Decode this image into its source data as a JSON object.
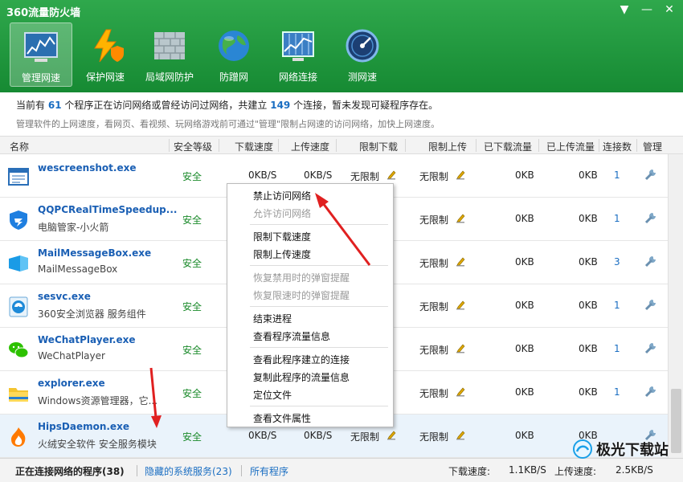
{
  "window": {
    "title": "360流量防火墙"
  },
  "nav": [
    {
      "label": "管理网速"
    },
    {
      "label": "保护网速"
    },
    {
      "label": "局域网防护"
    },
    {
      "label": "防蹭网"
    },
    {
      "label": "网络连接"
    },
    {
      "label": "测网速"
    }
  ],
  "info": {
    "pre": "当前有",
    "programs": "61",
    "mid": "个程序正在访问网络或曾经访问过网络，共建立",
    "connections": "149",
    "post": "个连接，暂未发现可疑程序存在。",
    "tip": "管理软件的上网速度，看网页、看视频、玩网络游戏前可通过\"管理\"限制占网速的访问网络，加快上网速度。"
  },
  "columns": [
    "名称",
    "安全等级",
    "下载速度",
    "上传速度",
    "限制下载",
    "限制上传",
    "已下载流量",
    "已上传流量",
    "连接数",
    "管理"
  ],
  "rows": [
    {
      "name": "wescreenshot.exe",
      "desc": "",
      "safety": "安全",
      "down": "0KB/S",
      "up": "0KB/S",
      "limit_down": "无限制",
      "limit_up": "无限制",
      "downloaded": "0KB",
      "uploaded": "0KB",
      "conns": "1"
    },
    {
      "name": "QQPCRealTimeSpeedup...",
      "desc": "电脑管家-小火箭",
      "safety": "安全",
      "down": "",
      "up": "",
      "limit_down": "",
      "limit_up": "无限制",
      "downloaded": "0KB",
      "uploaded": "0KB",
      "conns": "1"
    },
    {
      "name": "MailMessageBox.exe",
      "desc": "MailMessageBox",
      "safety": "安全",
      "down": "",
      "up": "",
      "limit_down": "",
      "limit_up": "无限制",
      "downloaded": "0KB",
      "uploaded": "0KB",
      "conns": "3"
    },
    {
      "name": "sesvc.exe",
      "desc": "360安全浏览器 服务组件",
      "safety": "安全",
      "down": "",
      "up": "",
      "limit_down": "",
      "limit_up": "无限制",
      "downloaded": "0KB",
      "uploaded": "0KB",
      "conns": "1"
    },
    {
      "name": "WeChatPlayer.exe",
      "desc": "WeChatPlayer",
      "safety": "安全",
      "down": "",
      "up": "",
      "limit_down": "",
      "limit_up": "无限制",
      "downloaded": "0KB",
      "uploaded": "0KB",
      "conns": "1"
    },
    {
      "name": "explorer.exe",
      "desc": "Windows资源管理器，它...",
      "safety": "安全",
      "down": "",
      "up": "",
      "limit_down": "",
      "limit_up": "无限制",
      "downloaded": "0KB",
      "uploaded": "0KB",
      "conns": "1"
    },
    {
      "name": "HipsDaemon.exe",
      "desc": "火绒安全软件 安全服务模块",
      "safety": "安全",
      "down": "0KB/S",
      "up": "0KB/S",
      "limit_down": "无限制",
      "limit_up": "无限制",
      "downloaded": "0KB",
      "uploaded": "0KB",
      "conns": ""
    }
  ],
  "context_menu": [
    {
      "label": "禁止访问网络",
      "enabled": true
    },
    {
      "label": "允许访问网络",
      "enabled": false
    },
    {
      "label": "限制下载速度",
      "enabled": true
    },
    {
      "label": "限制上传速度",
      "enabled": true
    },
    {
      "label": "恢复禁用时的弹窗提醒",
      "enabled": false
    },
    {
      "label": "恢复限速时的弹窗提醒",
      "enabled": false
    },
    {
      "label": "结束进程",
      "enabled": true
    },
    {
      "label": "查看程序流量信息",
      "enabled": true
    },
    {
      "label": "查看此程序建立的连接",
      "enabled": true
    },
    {
      "label": "复制此程序的流量信息",
      "enabled": true
    },
    {
      "label": "定位文件",
      "enabled": true
    },
    {
      "label": "查看文件属性",
      "enabled": true
    }
  ],
  "footer": {
    "tab_active": "正在连接网络的程序(38)",
    "tab_hidden": "隐藏的系统服务(23)",
    "tab_all": "所有程序",
    "down_label": "下载速度:",
    "down_value": "1.1KB/S",
    "up_label": "上传速度:",
    "up_value": "2.5KB/S"
  },
  "watermark": {
    "text": "极光下载站"
  },
  "colors": {
    "header": "#1f9a3e",
    "link": "#1a6ec2",
    "safe": "#1a8a2a",
    "arrow": "#e02020"
  }
}
